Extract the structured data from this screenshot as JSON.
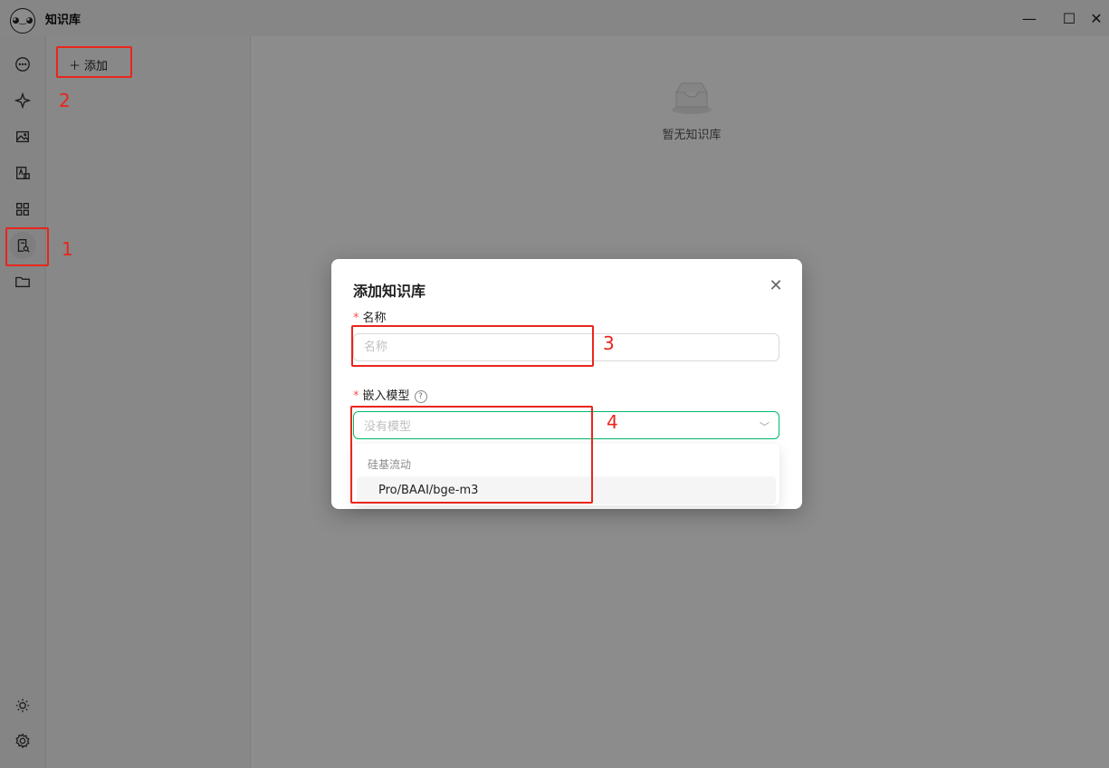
{
  "app": {
    "title": "知识库"
  },
  "window": {
    "min": "—",
    "max": "☐",
    "close": "✕"
  },
  "nav": {
    "icons": [
      "chat-icon",
      "sparkle-icon",
      "image-icon",
      "translate-icon",
      "apps-icon",
      "knowledge-icon",
      "folder-icon"
    ],
    "active": "knowledge-icon",
    "bottom": [
      "theme-icon",
      "settings-icon"
    ]
  },
  "sidebar": {
    "add_label": "添加"
  },
  "main": {
    "empty_text": "暂无知识库"
  },
  "modal": {
    "title": "添加知识库",
    "close": "✕",
    "name_label": "名称",
    "name_placeholder": "名称",
    "model_label": "嵌入模型",
    "help": "?",
    "model_placeholder": "没有模型",
    "dropdown": {
      "group": "硅基流动",
      "options": [
        "Pro/BAAI/bge-m3"
      ]
    }
  },
  "annotations": [
    "1",
    "2",
    "3",
    "4"
  ],
  "colors": {
    "accent": "#00b96b",
    "annotation": "#e8261c",
    "required": "#ff4d4f"
  }
}
